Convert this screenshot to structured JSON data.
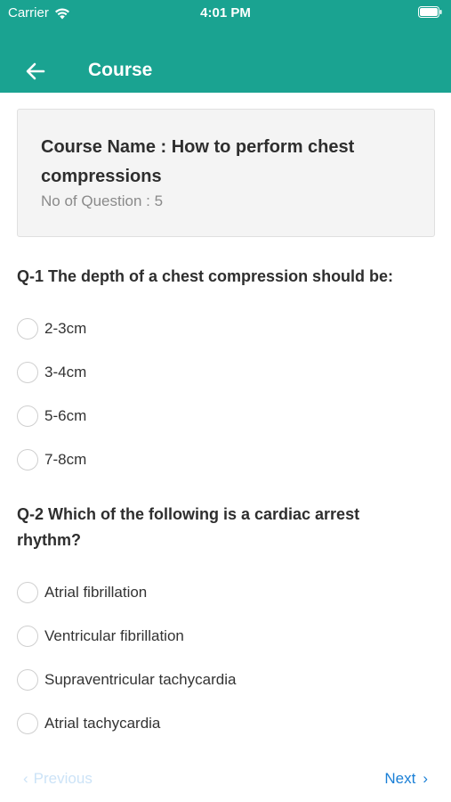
{
  "status": {
    "carrier": "Carrier",
    "time": "4:01 PM"
  },
  "nav": {
    "title": "Course"
  },
  "course": {
    "name": "Course Name : How to perform chest compressions",
    "question_count": "No of Question : 5"
  },
  "questions": [
    {
      "text": "Q-1 The depth of a chest compression should be:",
      "options": [
        "2-3cm",
        "3-4cm",
        "5-6cm",
        "7-8cm"
      ]
    },
    {
      "text": "Q-2 Which of the following is a cardiac arrest rhythm?",
      "options": [
        "Atrial fibrillation",
        "Ventricular fibrillation",
        "Supraventricular tachycardia",
        "Atrial tachycardia"
      ]
    }
  ],
  "footer": {
    "previous": "Previous",
    "next": "Next"
  },
  "colors": {
    "header": "#1aa391",
    "link": "#1a7fd6",
    "link_disabled": "#cce3f7"
  },
  "icons": {
    "back": "arrow-left-icon",
    "wifi": "wifi-icon",
    "battery": "battery-icon"
  }
}
